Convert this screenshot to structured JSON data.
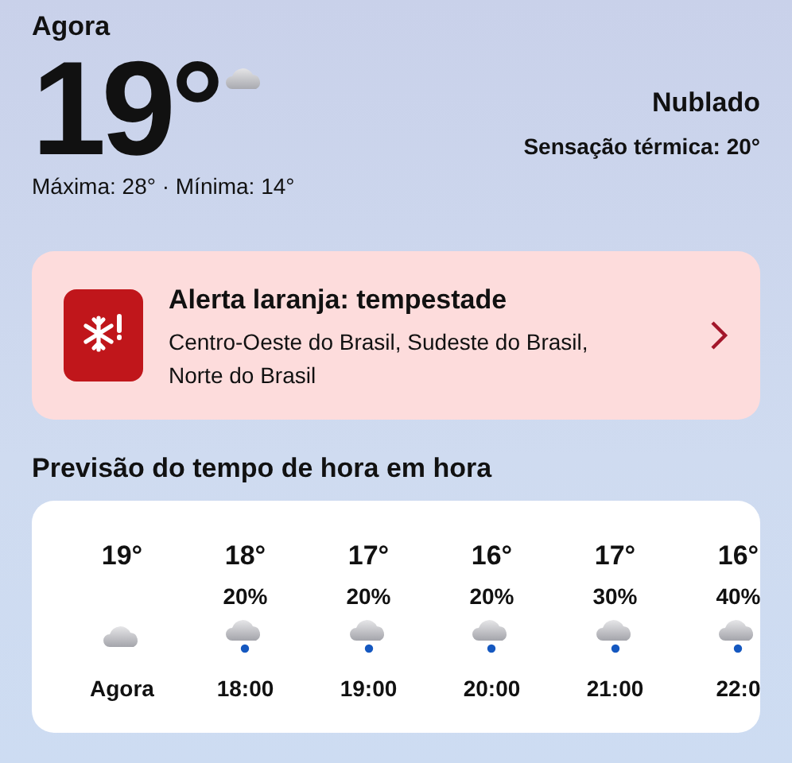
{
  "current": {
    "label": "Agora",
    "temperature": "19°",
    "condition": "Nublado",
    "feels_like": "Sensação térmica: 20°",
    "range": "Máxima: 28° · Mínima: 14°"
  },
  "alert": {
    "title": "Alerta laranja: tempestade",
    "regions": "Centro-Oeste do Brasil, Sudeste do Brasil, Norte do Brasil"
  },
  "hourly": {
    "title": "Previsão do tempo de hora em hora",
    "hours": [
      {
        "temperature": "19°",
        "rain": false,
        "time": "Agora"
      },
      {
        "temperature": "18°",
        "chance": "20%",
        "rain": true,
        "time": "18:00"
      },
      {
        "temperature": "17°",
        "chance": "20%",
        "rain": true,
        "time": "19:00"
      },
      {
        "temperature": "16°",
        "chance": "20%",
        "rain": true,
        "time": "20:00"
      },
      {
        "temperature": "17°",
        "chance": "30%",
        "rain": true,
        "time": "21:00"
      },
      {
        "temperature": "16°",
        "chance": "40%",
        "rain": true,
        "time": "22:0"
      }
    ]
  }
}
